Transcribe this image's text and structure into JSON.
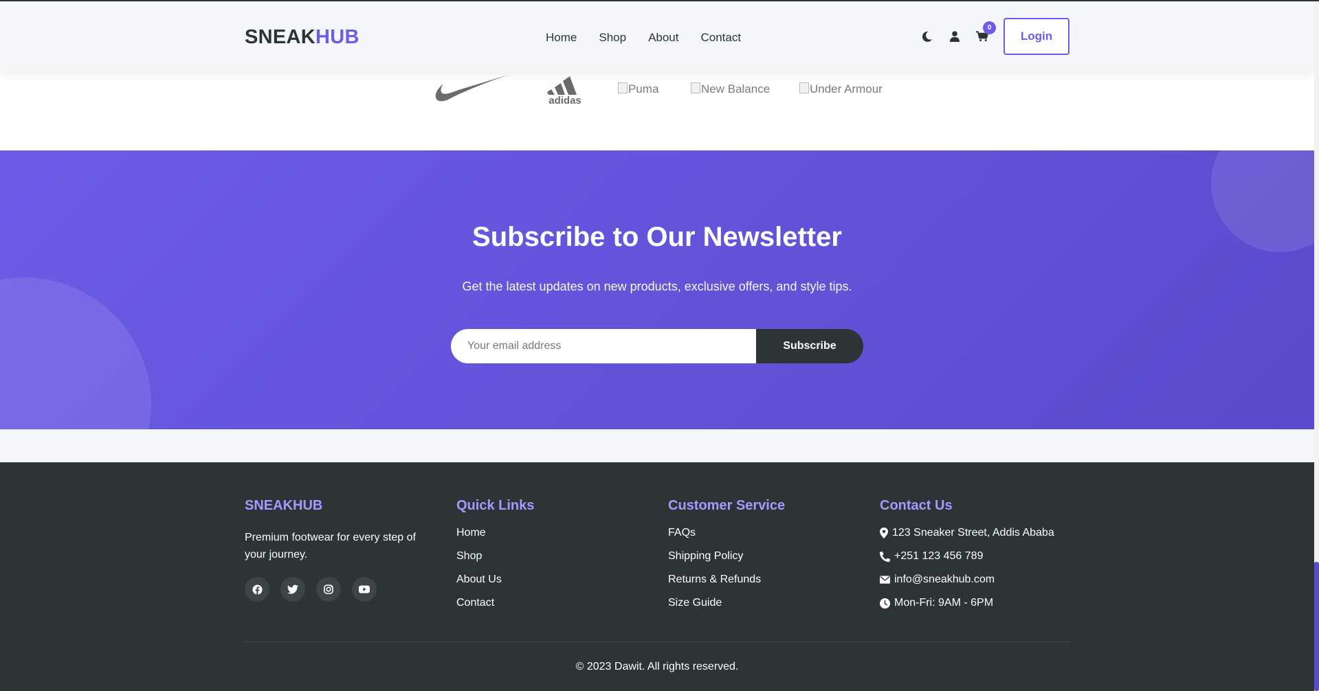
{
  "header": {
    "logo_part1": "SNEAK",
    "logo_part2": "HUB",
    "nav": [
      "Home",
      "Shop",
      "About",
      "Contact"
    ],
    "icons": [
      "moon-icon",
      "user-icon",
      "cart-icon"
    ],
    "cart_count": "0",
    "login_label": "Login"
  },
  "brands": {
    "logos": [
      "nike-logo",
      "adidas-logo"
    ],
    "broken_images": [
      "Puma",
      "New Balance",
      "Under Armour"
    ]
  },
  "newsletter": {
    "title": "Subscribe to Our Newsletter",
    "subtitle": "Get the latest updates on new products, exclusive offers, and style tips.",
    "email_placeholder": "Your email address",
    "button_label": "Subscribe"
  },
  "footer": {
    "brand": {
      "title": "SNEAKHUB",
      "tagline": "Premium footwear for every step of your journey.",
      "socials": [
        "facebook-icon",
        "twitter-icon",
        "instagram-icon",
        "youtube-icon"
      ]
    },
    "quick_links": {
      "title": "Quick Links",
      "items": [
        "Home",
        "Shop",
        "About Us",
        "Contact"
      ]
    },
    "customer_service": {
      "title": "Customer Service",
      "items": [
        "FAQs",
        "Shipping Policy",
        "Returns & Refunds",
        "Size Guide"
      ]
    },
    "contact": {
      "title": "Contact Us",
      "items": [
        {
          "icon": "map-pin-icon",
          "text": "123 Sneaker Street, Addis Ababa"
        },
        {
          "icon": "phone-icon",
          "text": "+251 123 456 789"
        },
        {
          "icon": "envelope-icon",
          "text": "info@sneakhub.com"
        },
        {
          "icon": "clock-icon",
          "text": "Mon-Fri: 9AM - 6PM"
        }
      ]
    },
    "copyright": "© 2023 Dawit. All rights reserved."
  },
  "colors": {
    "accent": "#6c5ce7",
    "accent_light": "#a29bfe",
    "dark": "#2d3436",
    "header_bg": "#f5f6fa"
  }
}
